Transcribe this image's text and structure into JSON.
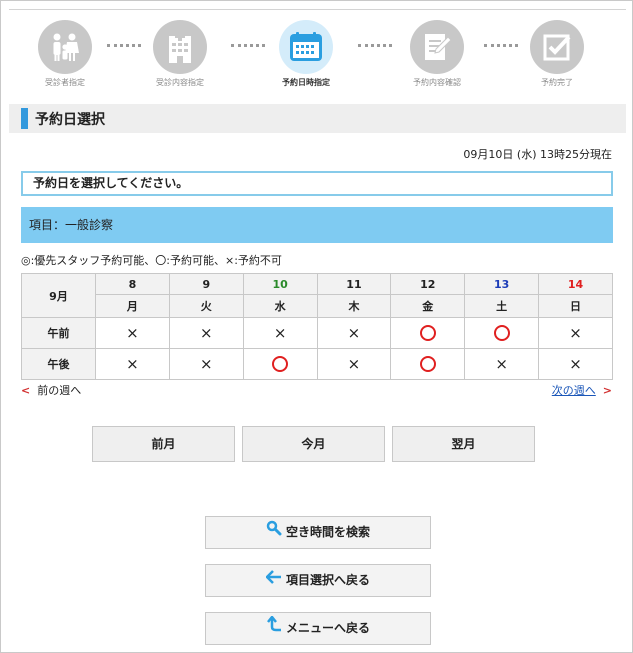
{
  "steps": [
    {
      "label": "受診者指定",
      "icon": "family-icon",
      "active": false
    },
    {
      "label": "受診内容指定",
      "icon": "hospital-icon",
      "active": false
    },
    {
      "label": "予約日時指定",
      "icon": "calendar-icon",
      "active": true
    },
    {
      "label": "予約内容確認",
      "icon": "form-edit-icon",
      "active": false
    },
    {
      "label": "予約完了",
      "icon": "checkbox-icon",
      "active": false
    }
  ],
  "section_title": "予約日選択",
  "current_time": "09月10日 (水) 13時25分現在",
  "instruction": "予約日を選択してください。",
  "item_label": "項目：一般診察",
  "legend": "◎:優先スタッフ予約可能、〇:予約可能、×:予約不可",
  "calendar": {
    "month": "9月",
    "days": [
      {
        "day": "8",
        "weekday": "月"
      },
      {
        "day": "9",
        "weekday": "火"
      },
      {
        "day": "10",
        "weekday": "水"
      },
      {
        "day": "11",
        "weekday": "木"
      },
      {
        "day": "12",
        "weekday": "金"
      },
      {
        "day": "13",
        "weekday": "土"
      },
      {
        "day": "14",
        "weekday": "日"
      }
    ],
    "rows": [
      {
        "label": "午前",
        "slots": [
          "×",
          "×",
          "×",
          "×",
          "〇",
          "〇",
          "×"
        ]
      },
      {
        "label": "午後",
        "slots": [
          "×",
          "×",
          "〇",
          "×",
          "〇",
          "×",
          "×"
        ]
      }
    ]
  },
  "nav": {
    "prev_week": "前の週へ",
    "next_week": "次の週へ"
  },
  "month_buttons": {
    "prev": "前月",
    "current": "今月",
    "next": "翌月"
  },
  "actions": {
    "search": "空き時間を検索",
    "back_item": "項目選択へ戻る",
    "back_menu": "メニューへ戻る"
  },
  "colors": {
    "accent": "#3399dd",
    "band": "#7fcbf2",
    "available": "#e02020",
    "saturday": "#1d3db8",
    "sunday": "#e02020",
    "today": "#2a8a2a"
  }
}
